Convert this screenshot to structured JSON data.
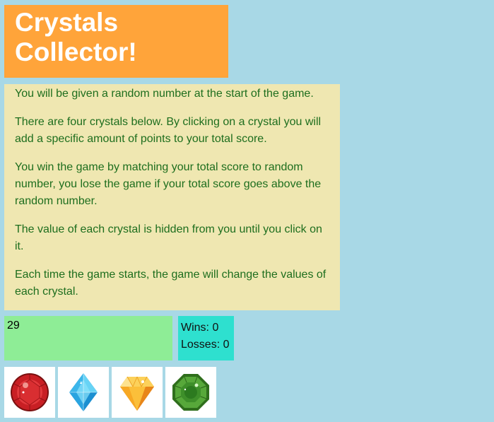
{
  "title": {
    "line1": "Crystals",
    "line2": "Collector!"
  },
  "instructions": [
    "You will be given a random number at the start of the game.",
    "There are four crystals below. By clicking on a crystal you will add a specific amount of points to your total score.",
    "You win the game by matching your total score to random number, you lose the game if your total score goes above the random number.",
    "The value of each crystal is hidden from you until you click on it.",
    "Each time the game starts, the game will change the values of each crystal."
  ],
  "target_number": "29",
  "scoreboard": {
    "wins": "Wins: 0",
    "losses": "Losses: 0"
  },
  "crystals": [
    {
      "icon": "red-round-gem-icon",
      "color": "#d42a2a"
    },
    {
      "icon": "blue-diamond-gem-icon",
      "color": "#3cc3f0"
    },
    {
      "icon": "yellow-topaz-gem-icon",
      "color": "#f7b52c"
    },
    {
      "icon": "green-octagon-gem-icon",
      "color": "#3e8f2a"
    }
  ],
  "colors": {
    "background": "#a8d8e6",
    "title_bg": "#ffa43a",
    "instructions_bg": "#efe7b1",
    "instructions_text": "#1e6e1e",
    "target_bg": "#8eed96",
    "score_bg": "#2ee0cf"
  }
}
